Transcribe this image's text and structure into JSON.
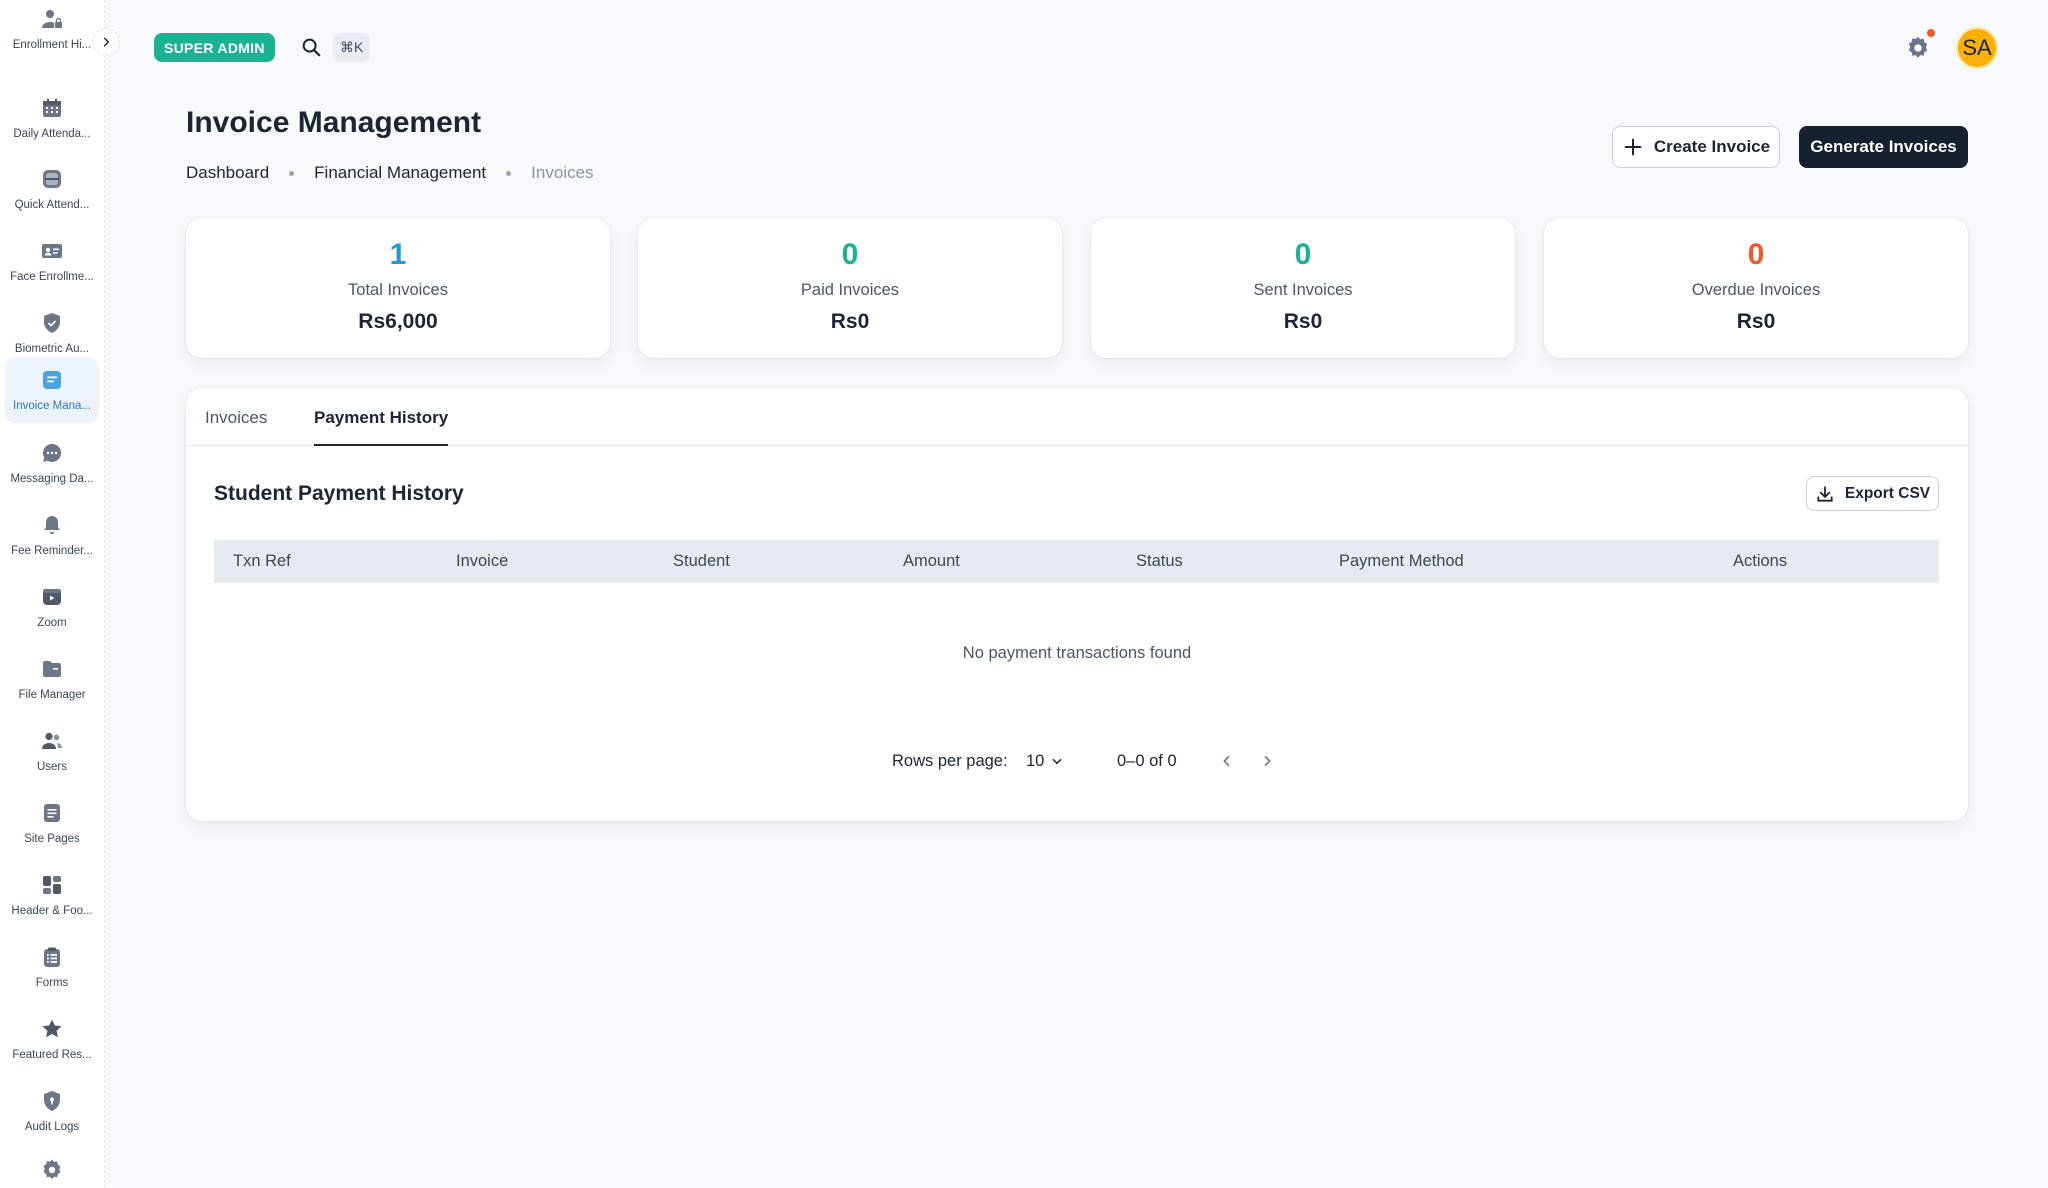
{
  "sidebar": {
    "items": [
      {
        "label": "Enrollment Hi...",
        "icon": "user-lock-icon"
      },
      {
        "label": "Daily Attenda...",
        "icon": "calendar-icon"
      },
      {
        "label": "Quick Attend...",
        "icon": "scan-icon"
      },
      {
        "label": "Face Enrollme...",
        "icon": "id-card-icon"
      },
      {
        "label": "Biometric Au...",
        "icon": "shield-check-icon"
      },
      {
        "label": "Invoice Mana...",
        "icon": "invoice-icon",
        "active": true
      },
      {
        "label": "Messaging Da...",
        "icon": "chat-icon"
      },
      {
        "label": "Fee Reminder...",
        "icon": "bell-icon"
      },
      {
        "label": "Zoom",
        "icon": "video-icon"
      },
      {
        "label": "File Manager",
        "icon": "folder-icon"
      },
      {
        "label": "Users",
        "icon": "users-icon"
      },
      {
        "label": "Site Pages",
        "icon": "page-icon"
      },
      {
        "label": "Header & Foo...",
        "icon": "layout-icon"
      },
      {
        "label": "Forms",
        "icon": "clipboard-icon"
      },
      {
        "label": "Featured Res...",
        "icon": "star-icon"
      },
      {
        "label": "Audit Logs",
        "icon": "shield-lock-icon"
      }
    ]
  },
  "topbar": {
    "role_badge": "SUPER ADMIN",
    "shortcut": "⌘K",
    "avatar_initials": "SA"
  },
  "header": {
    "title": "Invoice Management",
    "breadcrumbs": [
      "Dashboard",
      "Financial Management",
      "Invoices"
    ],
    "create_button": "Create Invoice",
    "generate_button": "Generate Invoices"
  },
  "stats": [
    {
      "value": "1",
      "label": "Total Invoices",
      "amount": "Rs6,000",
      "color": "#1e9bd7"
    },
    {
      "value": "0",
      "label": "Paid Invoices",
      "amount": "Rs0",
      "color": "#19b394"
    },
    {
      "value": "0",
      "label": "Sent Invoices",
      "amount": "Rs0",
      "color": "#19b394"
    },
    {
      "value": "0",
      "label": "Overdue Invoices",
      "amount": "Rs0",
      "color": "#f05a28"
    }
  ],
  "tabs": [
    "Invoices",
    "Payment History"
  ],
  "active_tab": "Payment History",
  "payment_history": {
    "title": "Student Payment History",
    "export_button": "Export CSV",
    "columns": [
      "Txn Ref",
      "Invoice",
      "Student",
      "Amount",
      "Status",
      "Payment Method",
      "Actions"
    ],
    "empty_message": "No payment transactions found",
    "pagination": {
      "rows_per_page_label": "Rows per page:",
      "rows_per_page": "10",
      "range": "0–0 of 0"
    }
  }
}
